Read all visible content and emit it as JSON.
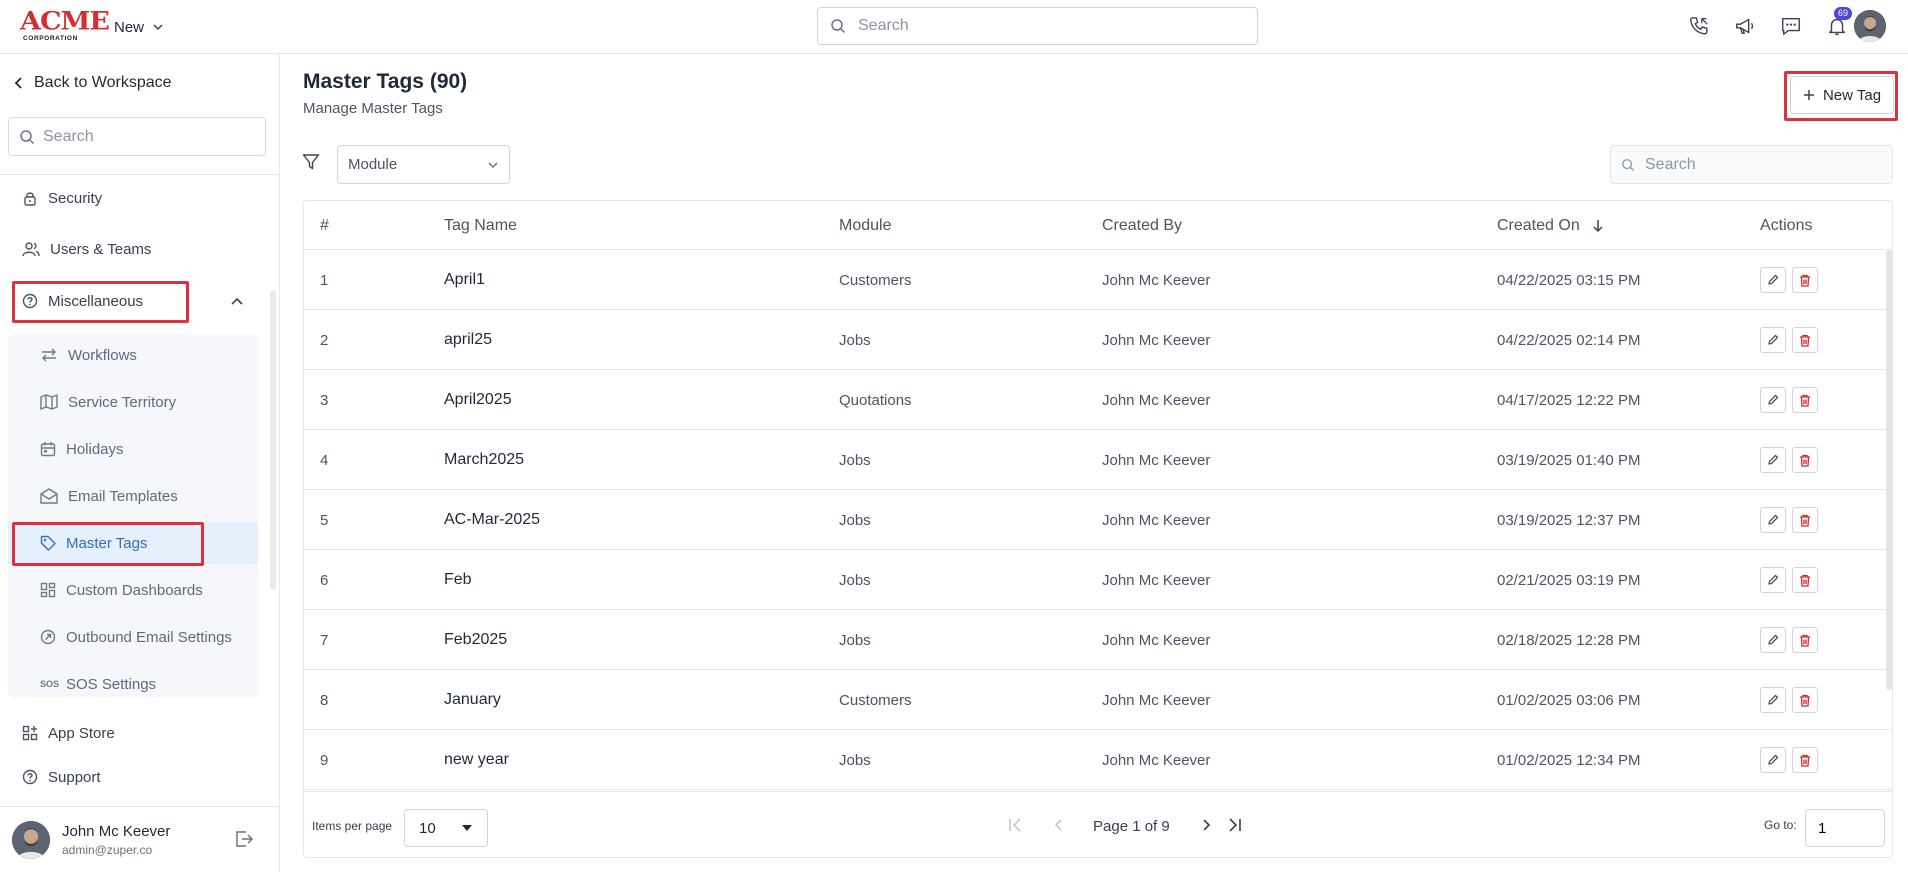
{
  "topbar": {
    "logo_main": "ACME",
    "logo_sub": "CORPORATION",
    "new_label": "New",
    "search_placeholder": "Search",
    "notification_count": "69"
  },
  "sidebar": {
    "back_label": "Back to Workspace",
    "search_placeholder": "Search",
    "items": [
      {
        "label": "Security",
        "icon": "lock-icon"
      },
      {
        "label": "Users & Teams",
        "icon": "users-icon"
      },
      {
        "label": "Miscellaneous",
        "icon": "help-circle-icon"
      }
    ],
    "sub_items": [
      {
        "label": "Workflows",
        "icon": "arrows-icon"
      },
      {
        "label": "Service Territory",
        "icon": "map-icon"
      },
      {
        "label": "Holidays",
        "icon": "calendar-icon"
      },
      {
        "label": "Email Templates",
        "icon": "mail-open-icon"
      },
      {
        "label": "Master Tags",
        "icon": "tag-icon",
        "active": true
      },
      {
        "label": "Custom Dashboards",
        "icon": "dashboard-icon"
      },
      {
        "label": "Outbound Email Settings",
        "icon": "at-icon"
      },
      {
        "label": "SOS Settings",
        "icon": "sos-icon",
        "icon_text": "SOS"
      }
    ],
    "bottom_items": [
      {
        "label": "App Store",
        "icon": "apps-icon"
      },
      {
        "label": "Support",
        "icon": "help-icon"
      }
    ],
    "user": {
      "name": "John Mc Keever",
      "email": "admin@zuper.co"
    }
  },
  "main": {
    "title": "Master Tags (90)",
    "subtitle": "Manage Master Tags",
    "new_tag_label": "New Tag",
    "module_filter_label": "Module",
    "search_placeholder": "Search",
    "columns": [
      "#",
      "Tag Name",
      "Module",
      "Created By",
      "Created On",
      "Actions"
    ],
    "rows": [
      {
        "num": "1",
        "tag": "April1",
        "module": "Customers",
        "created_by": "John Mc Keever",
        "created_on": "04/22/2025 03:15 PM"
      },
      {
        "num": "2",
        "tag": "april25",
        "module": "Jobs",
        "created_by": "John Mc Keever",
        "created_on": "04/22/2025 02:14 PM"
      },
      {
        "num": "3",
        "tag": "April2025",
        "module": "Quotations",
        "created_by": "John Mc Keever",
        "created_on": "04/17/2025 12:22 PM"
      },
      {
        "num": "4",
        "tag": "March2025",
        "module": "Jobs",
        "created_by": "John Mc Keever",
        "created_on": "03/19/2025 01:40 PM"
      },
      {
        "num": "5",
        "tag": "AC-Mar-2025",
        "module": "Jobs",
        "created_by": "John Mc Keever",
        "created_on": "03/19/2025 12:37 PM"
      },
      {
        "num": "6",
        "tag": "Feb",
        "module": "Jobs",
        "created_by": "John Mc Keever",
        "created_on": "02/21/2025 03:19 PM"
      },
      {
        "num": "7",
        "tag": "Feb2025",
        "module": "Jobs",
        "created_by": "John Mc Keever",
        "created_on": "02/18/2025 12:28 PM"
      },
      {
        "num": "8",
        "tag": "January",
        "module": "Customers",
        "created_by": "John Mc Keever",
        "created_on": "01/02/2025 03:06 PM"
      },
      {
        "num": "9",
        "tag": "new year",
        "module": "Jobs",
        "created_by": "John Mc Keever",
        "created_on": "01/02/2025 12:34 PM"
      }
    ],
    "pagination": {
      "items_per_page_label": "Items per page",
      "items_per_page": "10",
      "page_text": "Page 1 of 9",
      "goto_label": "Go to:",
      "goto_value": "1"
    }
  },
  "colors": {
    "highlight": "#d9333f",
    "active_bg": "#e6effc",
    "active_text": "#2d6ec6",
    "delete": "#dc2626",
    "badge": "#4f46e5"
  }
}
